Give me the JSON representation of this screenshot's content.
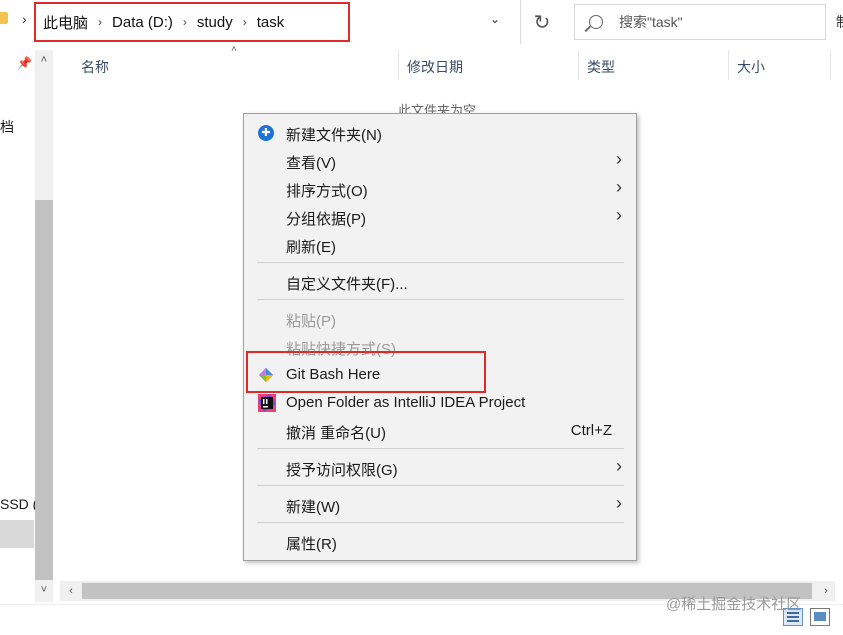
{
  "address_bar": {
    "breadcrumbs": [
      "此电脑",
      "Data (D:)",
      "study",
      "task"
    ],
    "separator": "›",
    "dropdown_glyph": "⌄",
    "refresh_glyph": "↻"
  },
  "search": {
    "placeholder": "搜索\"task\""
  },
  "right_edge_glyph": "制",
  "nav": {
    "doc_label": "档",
    "ssd_label": "SSD (",
    "scroll_up": "˄",
    "scroll_down": "˅"
  },
  "columns": [
    "名称",
    "修改日期",
    "类型",
    "大小"
  ],
  "sort_arrow": "˄",
  "empty_message": "此文件夹为空",
  "context_menu": {
    "items": [
      {
        "label": "新建文件夹(N)"
      },
      {
        "label": "查看(V)",
        "arrow": "›"
      },
      {
        "label": "排序方式(O)",
        "arrow": "›"
      },
      {
        "label": "分组依据(P)",
        "arrow": "›"
      },
      {
        "label": "刷新(E)"
      },
      {
        "label": "自定义文件夹(F)..."
      },
      {
        "label": "粘贴(P)"
      },
      {
        "label": "粘贴快捷方式(S)"
      },
      {
        "label": "Git Bash Here"
      },
      {
        "label": "Open Folder as IntelliJ IDEA Project"
      },
      {
        "label": "撤消 重命名(U)",
        "shortcut": "Ctrl+Z"
      },
      {
        "label": "授予访问权限(G)",
        "arrow": "›"
      },
      {
        "label": "新建(W)",
        "arrow": "›"
      },
      {
        "label": "属性(R)"
      }
    ]
  },
  "h_scroll": {
    "left": "‹",
    "right": "›"
  },
  "watermark": "@稀土掘金技术社区",
  "colors": {
    "highlight_box": "#e02a2a",
    "menu_bg": "#f2f2f2",
    "disabled_text": "#9a9a9a"
  }
}
